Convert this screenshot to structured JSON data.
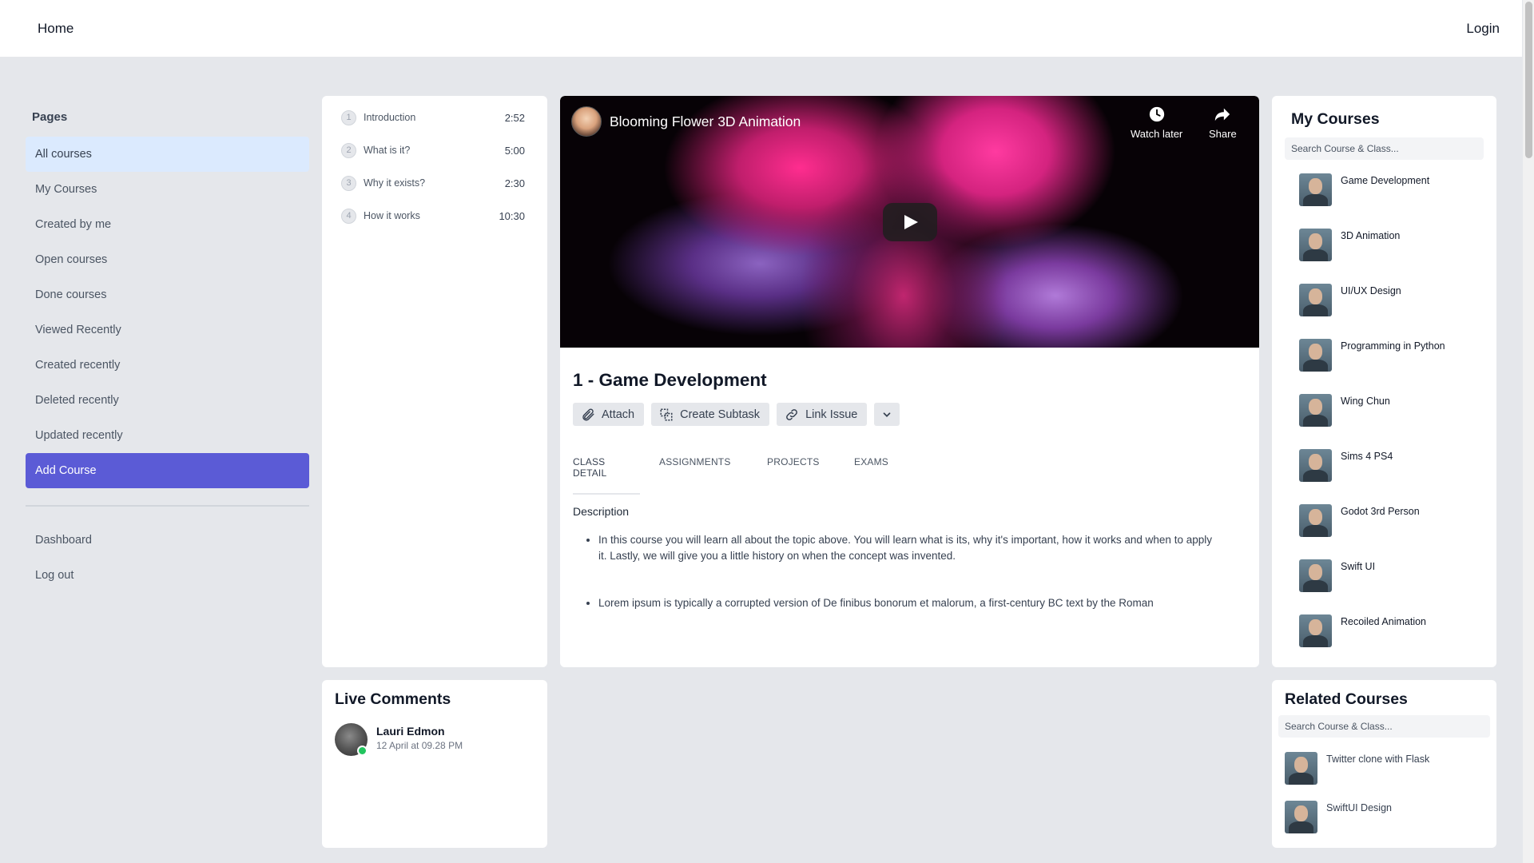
{
  "topbar": {
    "home": "Home",
    "login": "Login"
  },
  "sidebar": {
    "heading": "Pages",
    "items": [
      {
        "label": "All courses"
      },
      {
        "label": "My Courses"
      },
      {
        "label": "Created by me"
      },
      {
        "label": "Open courses"
      },
      {
        "label": "Done courses"
      },
      {
        "label": "Viewed Recently"
      },
      {
        "label": "Created recently"
      },
      {
        "label": "Deleted recently"
      },
      {
        "label": "Updated recently"
      }
    ],
    "add_course": "Add Course",
    "footer_items": [
      {
        "label": "Dashboard"
      },
      {
        "label": "Log out"
      }
    ]
  },
  "lessons": [
    {
      "num": "1",
      "title": "Introduction",
      "duration": "2:52"
    },
    {
      "num": "2",
      "title": "What is it?",
      "duration": "5:00"
    },
    {
      "num": "3",
      "title": "Why it exists?",
      "duration": "2:30"
    },
    {
      "num": "4",
      "title": "How it works",
      "duration": "10:30"
    }
  ],
  "video": {
    "title": "Blooming Flower 3D Animation",
    "watch_later": "Watch later",
    "share": "Share"
  },
  "course": {
    "title": "1 - Game Development",
    "actions": {
      "attach": "Attach",
      "create_subtask": "Create Subtask",
      "link_issue": "Link Issue"
    },
    "tabs": [
      "CLASS DETAIL",
      "ASSIGNMENTS",
      "PROJECTS",
      "EXAMS"
    ],
    "description_heading": "Description",
    "description": [
      "In this course you will learn all about the topic above. You will learn what is its, why it's important, how it works and when to apply it. Lastly, we will give you a little history on when the concept was invented.",
      "Lorem ipsum is typically a corrupted version of De finibus bonorum et malorum, a first-century BC text by the Roman"
    ]
  },
  "my_courses": {
    "title": "My Courses",
    "search_placeholder": "Search Course & Class...",
    "items": [
      {
        "name": "Game Development"
      },
      {
        "name": "3D Animation"
      },
      {
        "name": "UI/UX Design"
      },
      {
        "name": "Programming in Python"
      },
      {
        "name": "Wing Chun"
      },
      {
        "name": "Sims 4 PS4"
      },
      {
        "name": "Godot 3rd Person"
      },
      {
        "name": "Swift UI"
      },
      {
        "name": "Recoiled Animation"
      }
    ]
  },
  "live_comments": {
    "title": "Live Comments",
    "comments": [
      {
        "user": "Lauri Edmon",
        "time": "12 April at 09.28 PM"
      }
    ]
  },
  "related_courses": {
    "title": "Related Courses",
    "search_placeholder": "Search Course & Class...",
    "items": [
      {
        "name": "Twitter clone with Flask"
      },
      {
        "name": "SwiftUI Design"
      }
    ]
  },
  "colors": {
    "accent": "#5b5bd6",
    "active_nav": "#dbeafe",
    "online": "#22c55e"
  }
}
